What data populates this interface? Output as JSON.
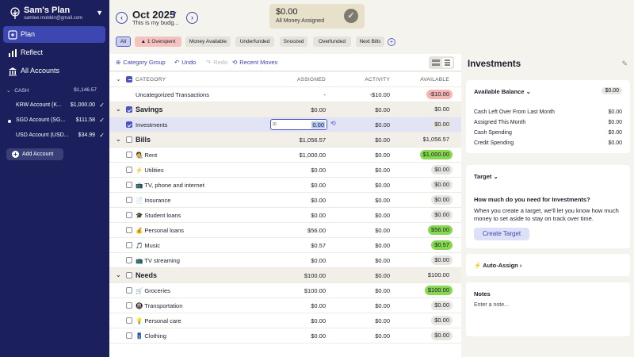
{
  "sidebar": {
    "plan_name": "Sam's Plan",
    "email": "samlee.mobbin@gmail.com",
    "nav": [
      {
        "label": "Plan",
        "icon": "plan-icon",
        "active": true
      },
      {
        "label": "Reflect",
        "icon": "reflect-icon",
        "active": false
      },
      {
        "label": "All Accounts",
        "icon": "bank-icon",
        "active": false
      }
    ],
    "cash": {
      "label": "CASH",
      "amount": "$1,146.57"
    },
    "accounts": [
      {
        "name": "KRW Account (K...",
        "amount": "$1,000.00",
        "dot": false
      },
      {
        "name": "SGD Account (SG...",
        "amount": "$111.58",
        "dot": true
      },
      {
        "name": "USD Account (USD...",
        "amount": "$34.99",
        "dot": false
      }
    ],
    "add_account": "Add Account"
  },
  "header": {
    "month": "Oct 2025",
    "subtitle": "This is my budg...",
    "assigned_amount": "$0.00",
    "assigned_label": "All Money Assigned"
  },
  "filters": [
    {
      "label": "All"
    },
    {
      "label": "1 Overspent"
    },
    {
      "label": "Money Available"
    },
    {
      "label": "Underfunded"
    },
    {
      "label": "Snoozed"
    },
    {
      "label": "Overfunded"
    },
    {
      "label": "Next Bills"
    }
  ],
  "toolbar": {
    "category_group": "Category Group",
    "undo": "Undo",
    "redo": "Redo",
    "recent_moves": "Recent Moves"
  },
  "table": {
    "headers": {
      "category": "CATEGORY",
      "assigned": "ASSIGNED",
      "activity": "ACTIVITY",
      "available": "AVAILABLE"
    },
    "rows": [
      {
        "type": "item",
        "name": "Uncategorized Transactions",
        "assigned": "-",
        "activity": "-$10.00",
        "available": "-$10.00",
        "pill": "red",
        "cb": "none"
      },
      {
        "type": "group",
        "name": "Savings",
        "assigned": "$0.00",
        "activity": "$0.00",
        "available": "$0.00",
        "pill": "",
        "cb": "on"
      },
      {
        "type": "item",
        "name": "Investments",
        "assigned": "0.00",
        "activity": "$0.00",
        "available": "$0.00",
        "pill": "gray",
        "cb": "on",
        "editing": true
      },
      {
        "type": "group",
        "name": "Bills",
        "assigned": "$1,056.57",
        "activity": "$0.00",
        "available": "$1,056.57",
        "pill": "",
        "cb": "off"
      },
      {
        "type": "item",
        "name": "🧑‍🎨 Rent",
        "assigned": "$1,000.00",
        "activity": "$0.00",
        "available": "$1,000.00",
        "pill": "green",
        "cb": "off"
      },
      {
        "type": "item",
        "name": "⚡ Utilities",
        "assigned": "$0.00",
        "activity": "$0.00",
        "available": "$0.00",
        "pill": "gray",
        "cb": "off"
      },
      {
        "type": "item",
        "name": "📺 TV, phone and internet",
        "assigned": "$0.00",
        "activity": "$0.00",
        "available": "$0.00",
        "pill": "gray",
        "cb": "off"
      },
      {
        "type": "item",
        "name": "📄 Insurance",
        "assigned": "$0.00",
        "activity": "$0.00",
        "available": "$0.00",
        "pill": "gray",
        "cb": "off"
      },
      {
        "type": "item",
        "name": "🎓 Student loans",
        "assigned": "$0.00",
        "activity": "$0.00",
        "available": "$0.00",
        "pill": "gray",
        "cb": "off"
      },
      {
        "type": "item",
        "name": "💰 Personal loans",
        "assigned": "$56.00",
        "activity": "$0.00",
        "available": "$56.00",
        "pill": "green",
        "cb": "off"
      },
      {
        "type": "item",
        "name": "🎵 Music",
        "assigned": "$0.57",
        "activity": "$0.00",
        "available": "$0.57",
        "pill": "green",
        "cb": "off"
      },
      {
        "type": "item",
        "name": "📺 TV streaming",
        "assigned": "$0.00",
        "activity": "$0.00",
        "available": "$0.00",
        "pill": "gray",
        "cb": "off"
      },
      {
        "type": "group",
        "name": "Needs",
        "assigned": "$100.00",
        "activity": "$0.00",
        "available": "$100.00",
        "pill": "",
        "cb": "off"
      },
      {
        "type": "item",
        "name": "🛒 Groceries",
        "assigned": "$100.00",
        "activity": "$0.00",
        "available": "$100.00",
        "pill": "green",
        "cb": "off"
      },
      {
        "type": "item",
        "name": "🚇 Transportation",
        "assigned": "$0.00",
        "activity": "$0.00",
        "available": "$0.00",
        "pill": "gray",
        "cb": "off"
      },
      {
        "type": "item",
        "name": "💡 Personal care",
        "assigned": "$0.00",
        "activity": "$0.00",
        "available": "$0.00",
        "pill": "gray",
        "cb": "off"
      },
      {
        "type": "item",
        "name": "👖 Clothing",
        "assigned": "$0.00",
        "activity": "$0.00",
        "available": "$0.00",
        "pill": "gray",
        "cb": "off"
      }
    ]
  },
  "inspector": {
    "title": "Investments",
    "available_balance_label": "Available Balance",
    "available_balance": "$0.00",
    "details": [
      {
        "label": "Cash Left Over From Last Month",
        "value": "$0.00"
      },
      {
        "label": "Assigned This Month",
        "value": "$0.00"
      },
      {
        "label": "Cash Spending",
        "value": "$0.00"
      },
      {
        "label": "Credit Spending",
        "value": "$0.00"
      }
    ],
    "target_label": "Target",
    "target_question": "How much do you need for Investments?",
    "target_text": "When you create a target, we'll let you know how much money to set aside to stay on track over time.",
    "create_target": "Create Target",
    "auto_assign": "Auto-Assign",
    "notes_label": "Notes",
    "notes_placeholder": "Enter a note..."
  },
  "colors": {
    "sidebar": "#1b1f5c",
    "accent": "#3b45b3",
    "green_pill": "#86d851",
    "red_pill": "#f6b7b2"
  }
}
